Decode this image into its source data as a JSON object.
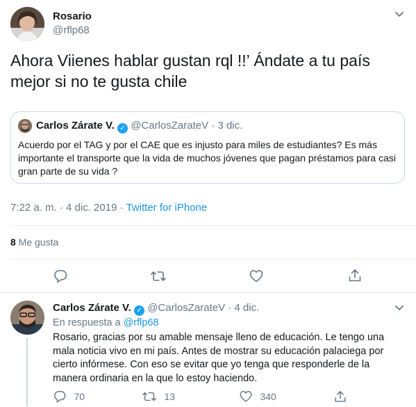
{
  "main_tweet": {
    "author_name": "Rosario",
    "author_handle": "@rflp68",
    "text_line1": "Ahora Viienes  hablar gustan rql !!’ Ándate a tu país",
    "text_line2": "mejor si no te gusta chile",
    "timestamp": "7:22 a. m. · 4 dic. 2019",
    "source_sep": "·",
    "source": "Twitter for iPhone",
    "likes_count": "8",
    "likes_label": "Me gusta"
  },
  "quoted_tweet": {
    "author_name": "Carlos Zárate V.",
    "author_handle": "@CarlosZarateV",
    "date": "· 3 dic.",
    "text": "Acuerdo por el TAG y por el CAE que es injusto para miles de estudiantes? Es más importante el transporte que la vida de muchos jóvenes que pagan préstamos para casi gran parte de su vida ?"
  },
  "reply_tweet": {
    "author_name": "Carlos Zárate V.",
    "author_handle": "@CarlosZarateV",
    "date": "· 4 dic.",
    "in_reply_prefix": "En respuesta a",
    "in_reply_handle": "@rflp68",
    "text": "Rosario, gracias por su amable mensaje lleno de educación. Le tengo una mala noticia vivo en mi país. Antes de mostrar su educación palaciega por cierto infórmese. Con eso se evitar que yo tenga que responderle de la manera ordinaria en la que lo estoy haciendo.",
    "reply_count": "70",
    "retweet_count": "13",
    "like_count": "340"
  },
  "colors": {
    "accent": "#1da1f2",
    "link": "#1b95e0",
    "muted": "#657786",
    "border": "#e6ecf0"
  },
  "icons": {
    "menu": "chevron-down-icon",
    "reply": "reply-icon",
    "retweet": "retweet-icon",
    "like": "heart-icon",
    "share": "share-icon",
    "verified": "verified-badge-icon"
  }
}
